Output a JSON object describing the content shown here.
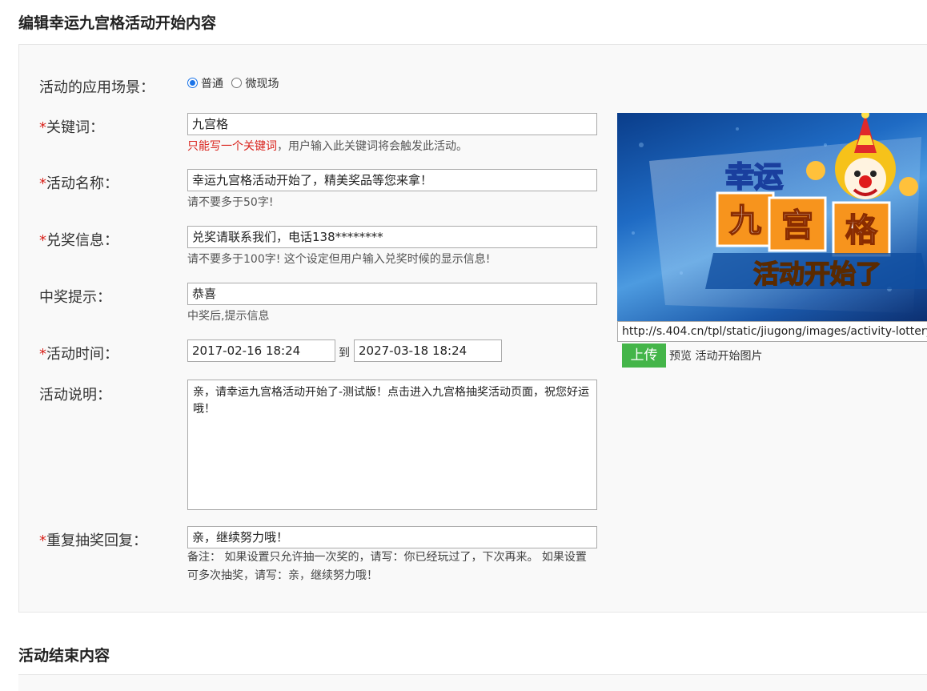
{
  "page": {
    "title": "编辑幸运九宫格活动开始内容",
    "end_section_title": "活动结束内容"
  },
  "form": {
    "scene": {
      "label": "活动的应用场景：",
      "options": [
        "普通",
        "微现场"
      ],
      "selected": "普通"
    },
    "keyword": {
      "label": "关键词：",
      "value": "九宫格",
      "hint_red": "只能写一个关键词",
      "hint": "，用户输入此关键词将会触发此活动。"
    },
    "name": {
      "label": "活动名称：",
      "value": "幸运九宫格活动开始了，精美奖品等您来拿！",
      "hint": "请不要多于50字!"
    },
    "prize_info": {
      "label": "兑奖信息：",
      "value": "兑奖请联系我们，电话138********",
      "hint": "请不要多于100字! 这个设定但用户输入兑奖时候的显示信息!"
    },
    "win_tip": {
      "label": "中奖提示：",
      "value": "恭喜",
      "hint": "中奖后,提示信息"
    },
    "time": {
      "label": "活动时间：",
      "start": "2017-02-16 18:24",
      "to": "到",
      "end": "2027-03-18 18:24"
    },
    "desc": {
      "label": "活动说明：",
      "value": "亲，请幸运九宫格活动开始了-测试版！点击进入九宫格抽奖活动页面，祝您好运哦！"
    },
    "repeat_reply": {
      "label": "重复抽奖回复：",
      "value": "亲，继续努力哦！",
      "note": "备注： 如果设置只允许抽一次奖的，请写：你已经玩过了，下次再来。 如果设置可多次抽奖，请写：亲，继续努力哦！"
    },
    "required_mark": "*"
  },
  "image": {
    "line1": "幸运",
    "tiles": [
      "九",
      "宫",
      "格"
    ],
    "banner": "活动开始了",
    "url": "http://s.404.cn/tpl/static/jiugong/images/activity-lottery-start.jpg",
    "upload_label": "上传",
    "preview_label": "预览",
    "caption": "活动开始图片"
  },
  "colors": {
    "required": "#d9231c",
    "upload_button": "#44b549"
  }
}
